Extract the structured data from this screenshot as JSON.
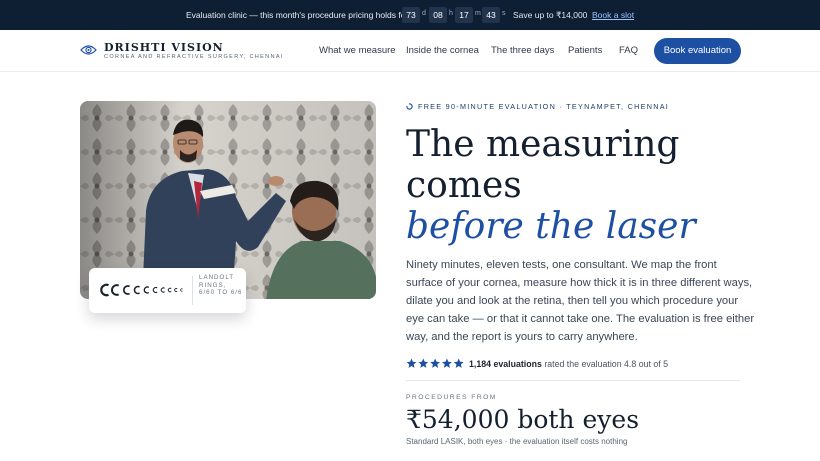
{
  "promo": {
    "message": "Evaluation clinic — this month's procedure pricing holds for",
    "countdown": [
      {
        "value": "73",
        "unit": "d"
      },
      {
        "value": "08",
        "unit": "h"
      },
      {
        "value": "17",
        "unit": "m"
      },
      {
        "value": "43",
        "unit": "s"
      }
    ],
    "save_text": "Save up to ₹14,000",
    "cta_label": "Book a slot"
  },
  "header": {
    "brand": "DRISHTI VISION",
    "tagline": "CORNEA AND REFRACTIVE SURGERY, CHENNAI",
    "nav": [
      "What we measure",
      "Inside the cornea",
      "The three days",
      "Patients",
      "FAQ"
    ],
    "book_label": "Book evaluation"
  },
  "photo_card": {
    "caption": "LANDOLT RINGS, 6/60 TO 6/6"
  },
  "hero": {
    "eyebrow": "FREE 90-MINUTE EVALUATION · TEYNAMPET, CHENNAI",
    "headline_1": "The measuring",
    "headline_2": "comes",
    "headline_3": "before the laser",
    "lede": [
      "Ninety minutes, eleven tests, one consultant. We map the front",
      "surface of your cornea, measure how thick it is in three different ways,",
      "dilate you and look at the retina, then tell you which procedure your",
      "eye can take — or that it cannot take one. The evaluation is free either",
      "way, and the report is yours to carry anywhere."
    ],
    "rating": {
      "stars": 5,
      "count": "1,184 evaluations",
      "text": "rated the evaluation 4.8 out of 5"
    },
    "procedures_label": "PROCEDURES FROM",
    "price": "₹54,000 both eyes",
    "price_note": "Standard LASIK, both eyes · the evaluation itself costs nothing"
  },
  "colors": {
    "accent": "#1d4fa3",
    "promo_bg": "#0f1f33",
    "star": "#1d4fa3"
  },
  "icons": {
    "logo": "eye-icon",
    "eyebrow": "spinner-icon",
    "rating": "star-icon"
  }
}
